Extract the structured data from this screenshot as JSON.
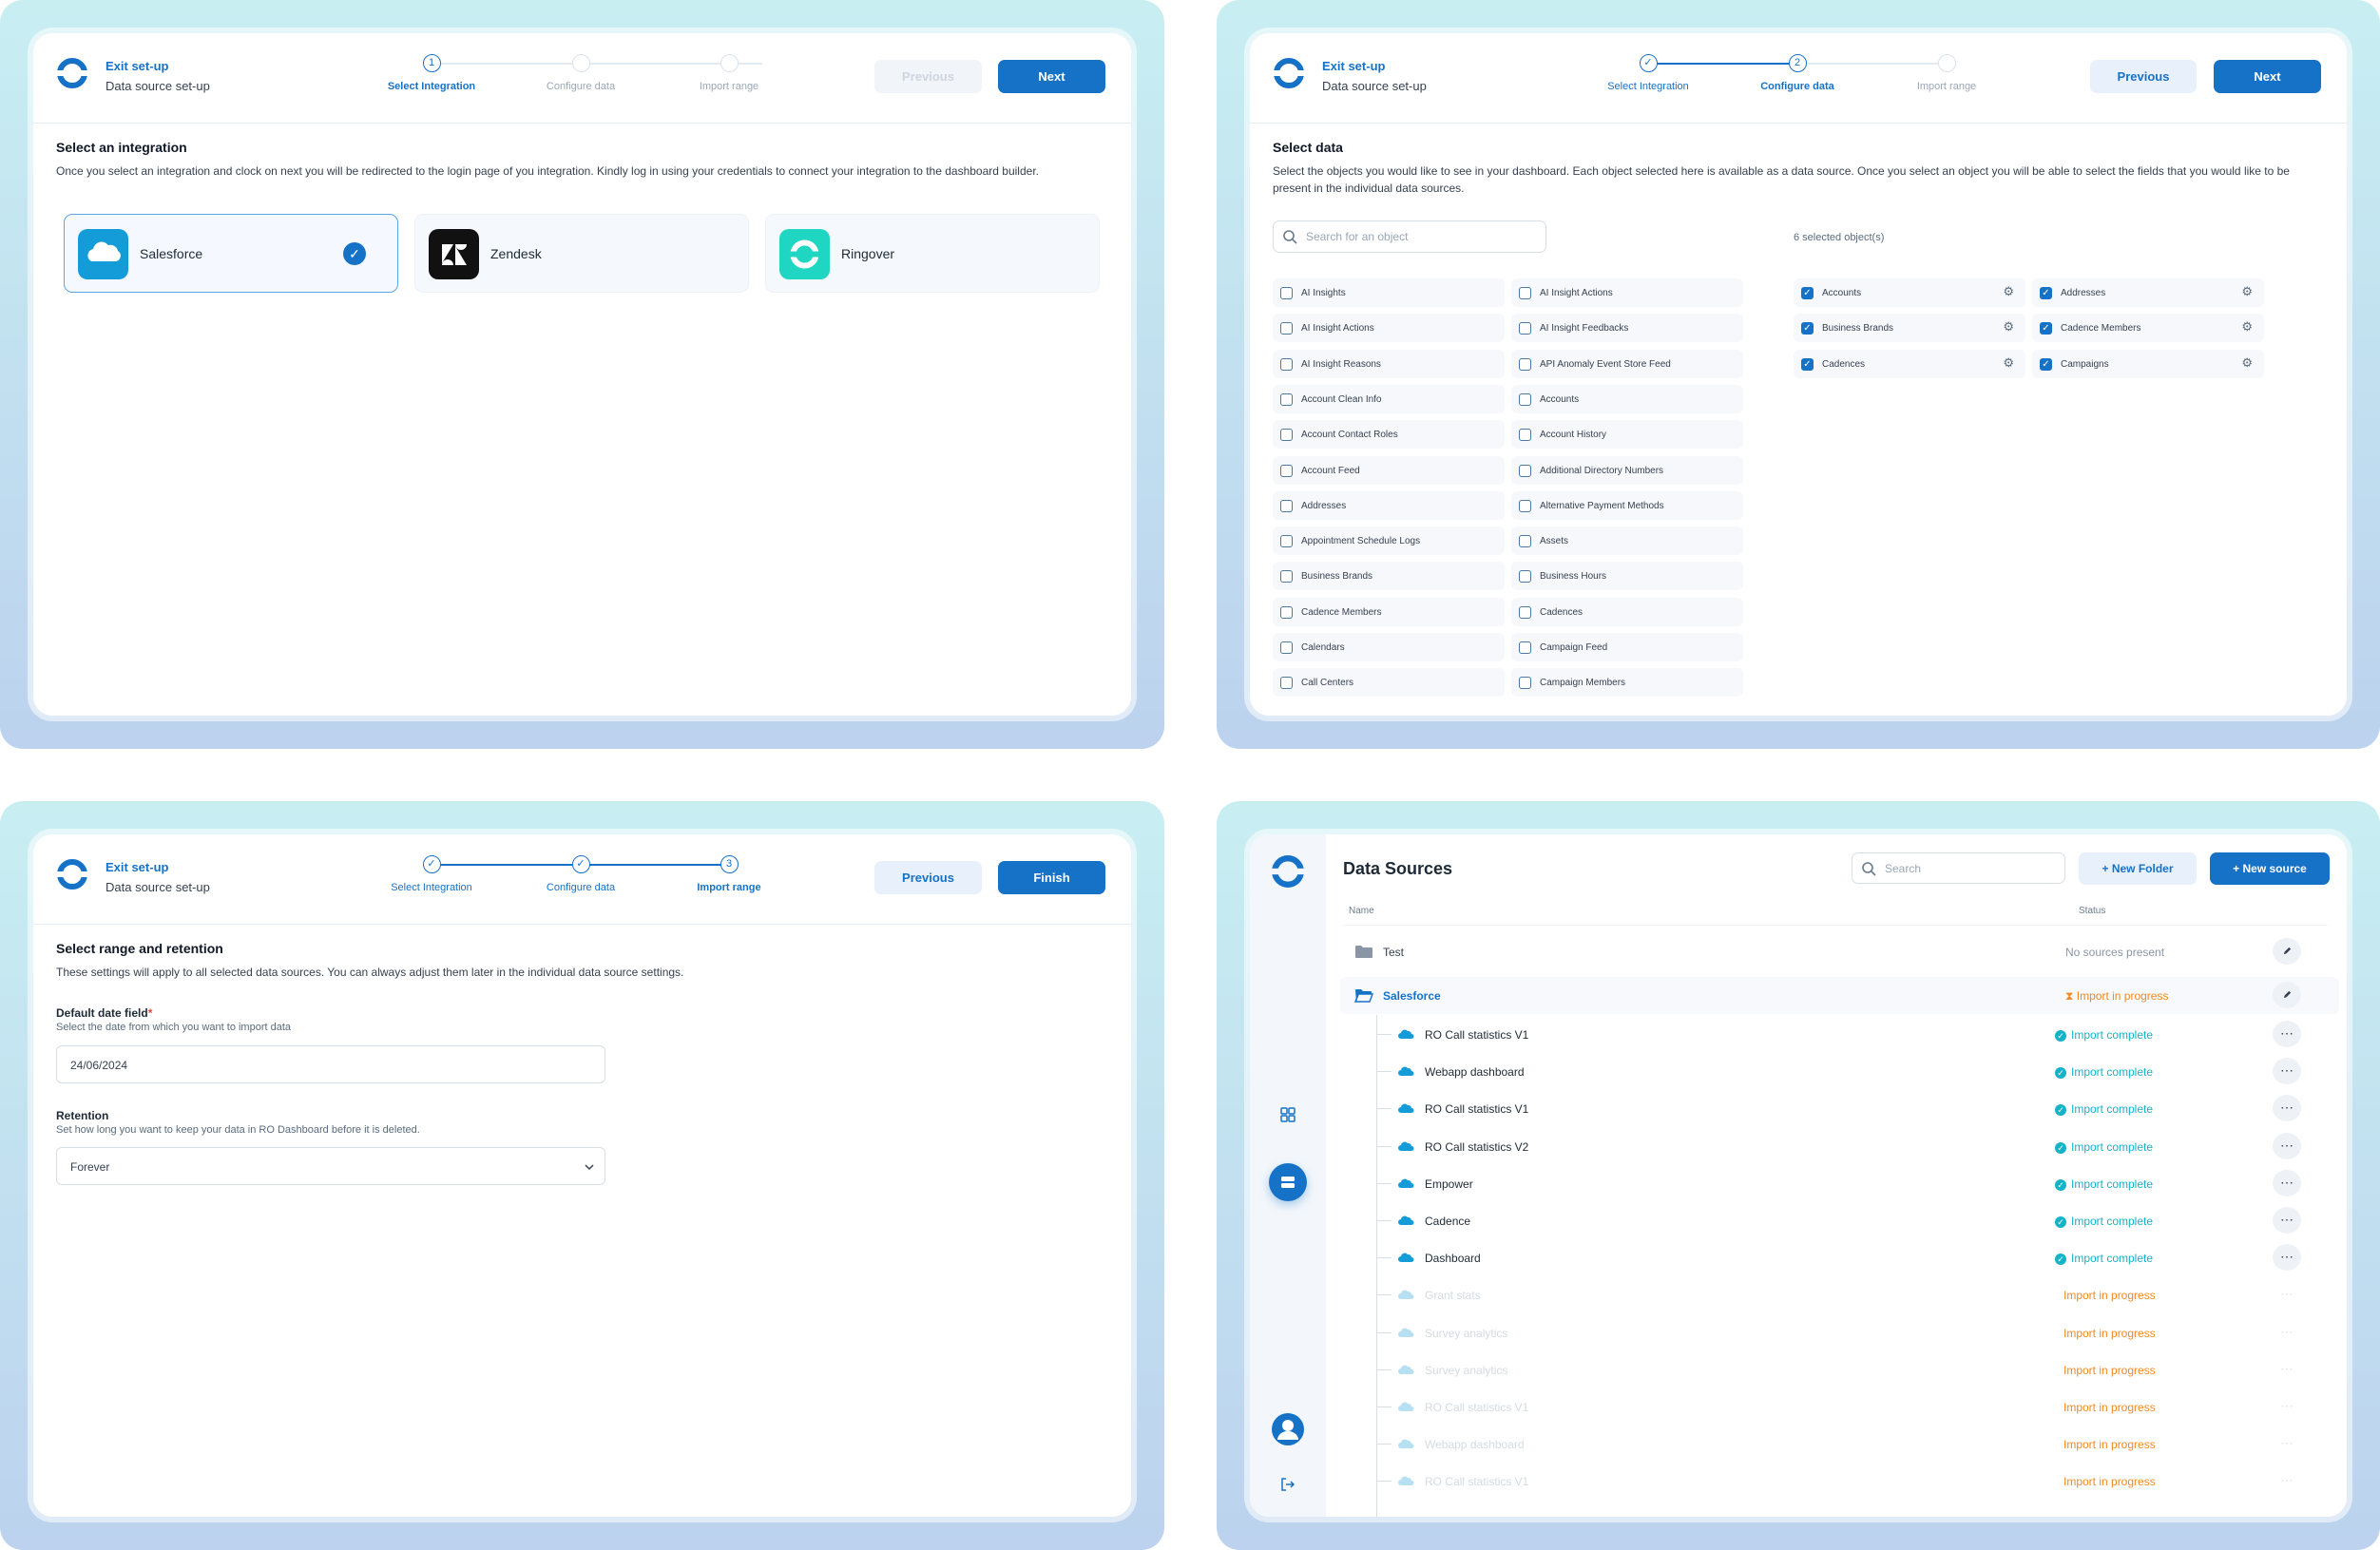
{
  "colors": {
    "primary": "#1672c7",
    "complete": "#14b3c8",
    "progress": "#f08a24"
  },
  "header": {
    "exit": "Exit set-up",
    "subtitle": "Data source set-up"
  },
  "steps": [
    "Select Integration",
    "Configure data",
    "Import range"
  ],
  "buttons": {
    "previous": "Previous",
    "next": "Next",
    "finish": "Finish"
  },
  "panel1": {
    "title": "Select an integration",
    "description": "Once you select an integration and clock on next you will be redirected to the login page of you integration. Kindly log in using your credentials to connect your integration to the dashboard builder.",
    "integrations": [
      {
        "name": "Salesforce",
        "icon": "salesforce-icon",
        "selected": true
      },
      {
        "name": "Zendesk",
        "icon": "zendesk-icon",
        "selected": false
      },
      {
        "name": "Ringover",
        "icon": "ringover-icon",
        "selected": false
      }
    ],
    "step_number": "1"
  },
  "panel2": {
    "title": "Select data",
    "description": "Select the objects you would like to see in your dashboard. Each object selected here is available as a data source. Once you select an object you will be able to select the fields that you would like to be present in the individual data sources.",
    "search_placeholder": "Search for an object",
    "selected_count": "6 selected object(s)",
    "col1": [
      "AI Insights",
      "AI Insight Actions",
      "AI Insight Reasons",
      "Account Clean Info",
      "Account Contact Roles",
      "Account Feed",
      "Addresses",
      "Appointment Schedule Logs",
      "Business Brands",
      "Cadence Members",
      "Calendars",
      "Call Centers"
    ],
    "col2": [
      "AI Insight Actions",
      "AI Insight Feedbacks",
      "API Anomaly Event Store Feed",
      "Accounts",
      "Account History",
      "Additional Directory Numbers",
      "Alternative Payment Methods",
      "Assets",
      "Business Hours",
      "Cadences",
      "Campaign Feed",
      "Campaign Members"
    ],
    "selected": [
      "Accounts",
      "Addresses",
      "Business Brands",
      "Cadence Members",
      "Cadences",
      "Campaigns"
    ],
    "step_number": "2"
  },
  "panel3": {
    "title": "Select range and retention",
    "description": "These settings will apply to all selected data sources. You can always adjust them later in the individual data source settings.",
    "date_label": "Default date field",
    "required_mark": "*",
    "date_help": "Select the date from which you want to import data",
    "date_value": "24/06/2024",
    "retention_label": "Retention",
    "retention_help": "Set how long you want to keep your data in RO Dashboard before it is deleted.",
    "retention_value": "Forever",
    "step_number": "3"
  },
  "panel4": {
    "title": "Data Sources",
    "search_placeholder": "Search",
    "new_folder": "New Folder",
    "new_source": "New source",
    "col_name": "Name",
    "col_status": "Status",
    "folders": [
      {
        "name": "Test",
        "status": "No sources present"
      },
      {
        "name": "Salesforce",
        "status": "Import in progress"
      }
    ],
    "sources": [
      {
        "name": "RO Call statistics V1",
        "status": "Import complete",
        "state": "complete"
      },
      {
        "name": "Webapp dashboard",
        "status": "Import complete",
        "state": "complete"
      },
      {
        "name": "RO Call statistics V1",
        "status": "Import complete",
        "state": "complete"
      },
      {
        "name": "RO Call statistics V2",
        "status": "Import complete",
        "state": "complete"
      },
      {
        "name": "Empower",
        "status": "Import complete",
        "state": "complete"
      },
      {
        "name": "Cadence",
        "status": "Import complete",
        "state": "complete"
      },
      {
        "name": "Dashboard",
        "status": "Import complete",
        "state": "complete"
      },
      {
        "name": "Grant stats",
        "status": "Import in progress",
        "state": "progress"
      },
      {
        "name": "Survey analytics",
        "status": "Import in progress",
        "state": "progress"
      },
      {
        "name": "Survey analytics",
        "status": "Import in progress",
        "state": "progress"
      },
      {
        "name": "RO Call statistics V1",
        "status": "Import in progress",
        "state": "progress"
      },
      {
        "name": "Webapp dashboard",
        "status": "Import in progress",
        "state": "progress"
      },
      {
        "name": "RO Call statistics V1",
        "status": "Import in progress",
        "state": "progress"
      }
    ]
  }
}
